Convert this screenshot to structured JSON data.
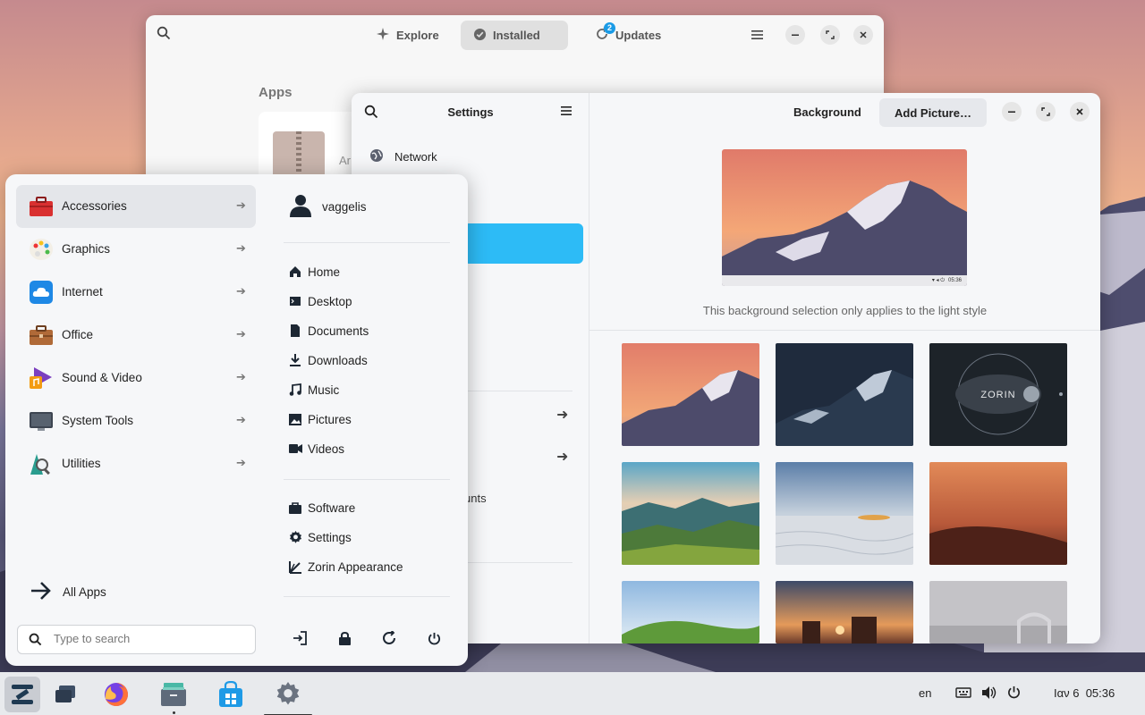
{
  "software": {
    "tabs": [
      {
        "label": "Explore",
        "icon": "sparkle-icon"
      },
      {
        "label": "Installed",
        "icon": "check-icon"
      },
      {
        "label": "Updates",
        "icon": "refresh-icon",
        "badge": "2"
      }
    ],
    "section_title": "Apps",
    "card_text": "Ar"
  },
  "settings": {
    "sidebar_title": "Settings",
    "network_label": "Network",
    "partial_label": "unts",
    "main_title": "Background",
    "add_picture_label": "Add Picture…",
    "note": "This background selection only applies to the light style",
    "preview_clock": "05:36"
  },
  "menu": {
    "categories": [
      {
        "label": "Accessories",
        "icon": "toolbox-icon"
      },
      {
        "label": "Graphics",
        "icon": "palette-icon"
      },
      {
        "label": "Internet",
        "icon": "cloud-icon"
      },
      {
        "label": "Office",
        "icon": "briefcase-icon"
      },
      {
        "label": "Sound & Video",
        "icon": "music-icon"
      },
      {
        "label": "System Tools",
        "icon": "monitor-icon"
      },
      {
        "label": "Utilities",
        "icon": "utilities-icon"
      }
    ],
    "all_apps_label": "All Apps",
    "search_placeholder": "Type to search",
    "username": "vaggelis",
    "places": [
      {
        "label": "Home",
        "icon": "home-icon"
      },
      {
        "label": "Desktop",
        "icon": "desktop-icon"
      },
      {
        "label": "Documents",
        "icon": "document-icon"
      },
      {
        "label": "Downloads",
        "icon": "download-icon"
      },
      {
        "label": "Music",
        "icon": "music-note-icon"
      },
      {
        "label": "Pictures",
        "icon": "image-icon"
      },
      {
        "label": "Videos",
        "icon": "video-icon"
      }
    ],
    "apps": [
      {
        "label": "Software",
        "icon": "bag-icon"
      },
      {
        "label": "Settings",
        "icon": "gear-icon"
      },
      {
        "label": "Zorin Appearance",
        "icon": "appearance-icon"
      }
    ]
  },
  "taskbar": {
    "language": "en",
    "clock": "Ιαν 6  05:36"
  },
  "colors": {
    "accent": "#2dbbf6",
    "badge": "#1a9be6"
  }
}
